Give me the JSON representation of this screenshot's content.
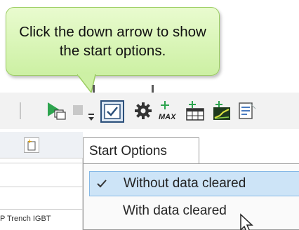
{
  "callout": {
    "text": "Click the down arrow to show the start options."
  },
  "toolbar": {
    "buttons": [
      {
        "name": "run-icon",
        "interactable": true
      },
      {
        "name": "stop-icon",
        "interactable": true
      },
      {
        "name": "start-options-arrow",
        "interactable": true
      },
      {
        "name": "checkbox-icon",
        "interactable": true
      },
      {
        "name": "settings-gear-icon",
        "interactable": true
      },
      {
        "name": "max-icon",
        "interactable": true,
        "label": "MAX"
      },
      {
        "name": "table-add-icon",
        "interactable": true
      },
      {
        "name": "chart-add-icon",
        "interactable": true
      },
      {
        "name": "document-icon",
        "interactable": true
      }
    ]
  },
  "panel": {
    "row_label": "P Trench IGBT"
  },
  "start_options_menu": {
    "title": "Start Options",
    "items": [
      {
        "label": "Without data cleared",
        "checked": true,
        "highlighted": true
      },
      {
        "label": "With data cleared",
        "checked": false,
        "highlighted": false
      }
    ]
  },
  "colors": {
    "callout_fill": "#d9f5b8",
    "callout_border": "#9ccd63",
    "menu_highlight": "#cde4f7",
    "run_green": "#2da44e"
  }
}
